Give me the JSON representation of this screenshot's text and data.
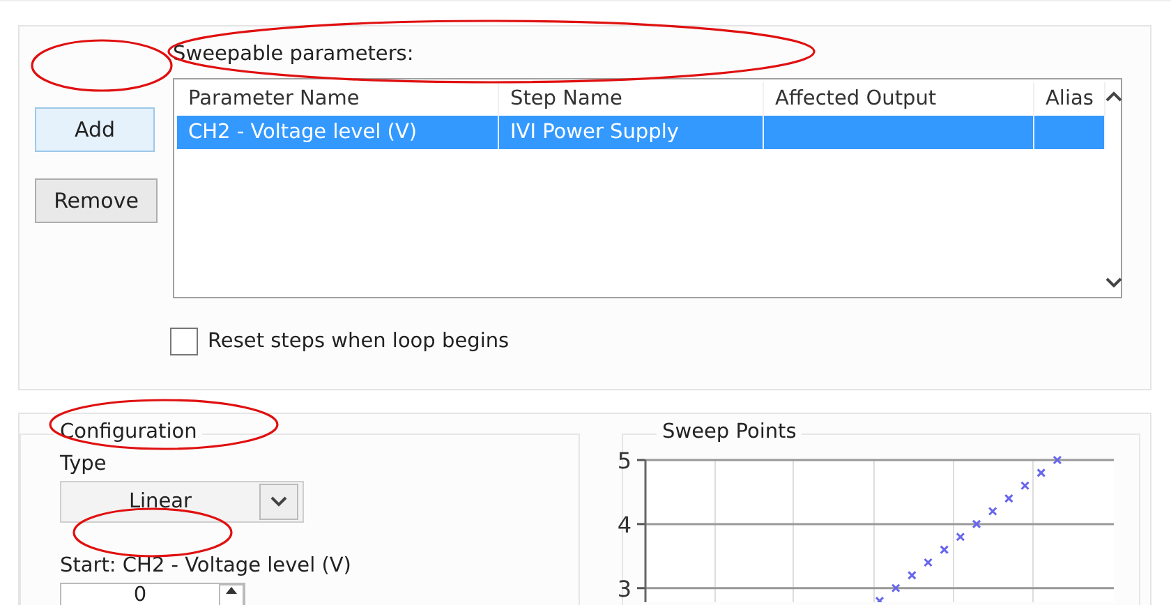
{
  "sweep_panel": {
    "label": "Sweepable parameters:",
    "buttons": [
      {
        "label": "Add",
        "kind": "focused"
      },
      {
        "label": "Remove",
        "kind": "normal"
      }
    ],
    "table": {
      "columns": [
        "Parameter Name",
        "Step Name",
        "Affected Output",
        "Alias"
      ],
      "rows": [
        {
          "cells": [
            "CH2 - Voltage level (V)",
            "IVI Power Supply",
            "",
            ""
          ],
          "selected": true
        }
      ]
    },
    "reset_checkbox": {
      "label": "Reset steps when loop begins",
      "checked": false
    }
  },
  "configuration": {
    "title": "Configuration",
    "type_label": "Type",
    "type_value": "Linear",
    "start_label": "Start: CH2 - Voltage level (V)",
    "start_value": "0"
  },
  "sweep_points": {
    "title": "Sweep Points",
    "chart_data": {
      "type": "scatter",
      "series": [
        {
          "color": "#6666ee",
          "values": [
            null,
            null,
            null,
            null,
            null,
            null,
            null,
            null,
            null,
            null,
            null,
            null,
            null,
            null,
            2.8,
            3.0,
            3.2,
            3.4,
            3.6,
            3.8,
            4.0,
            4.2,
            4.4,
            4.6,
            4.8,
            5.0,
            null,
            null,
            null
          ]
        }
      ],
      "ylim": [
        2.78,
        5
      ],
      "yticks": [
        3,
        4,
        5
      ]
    }
  }
}
